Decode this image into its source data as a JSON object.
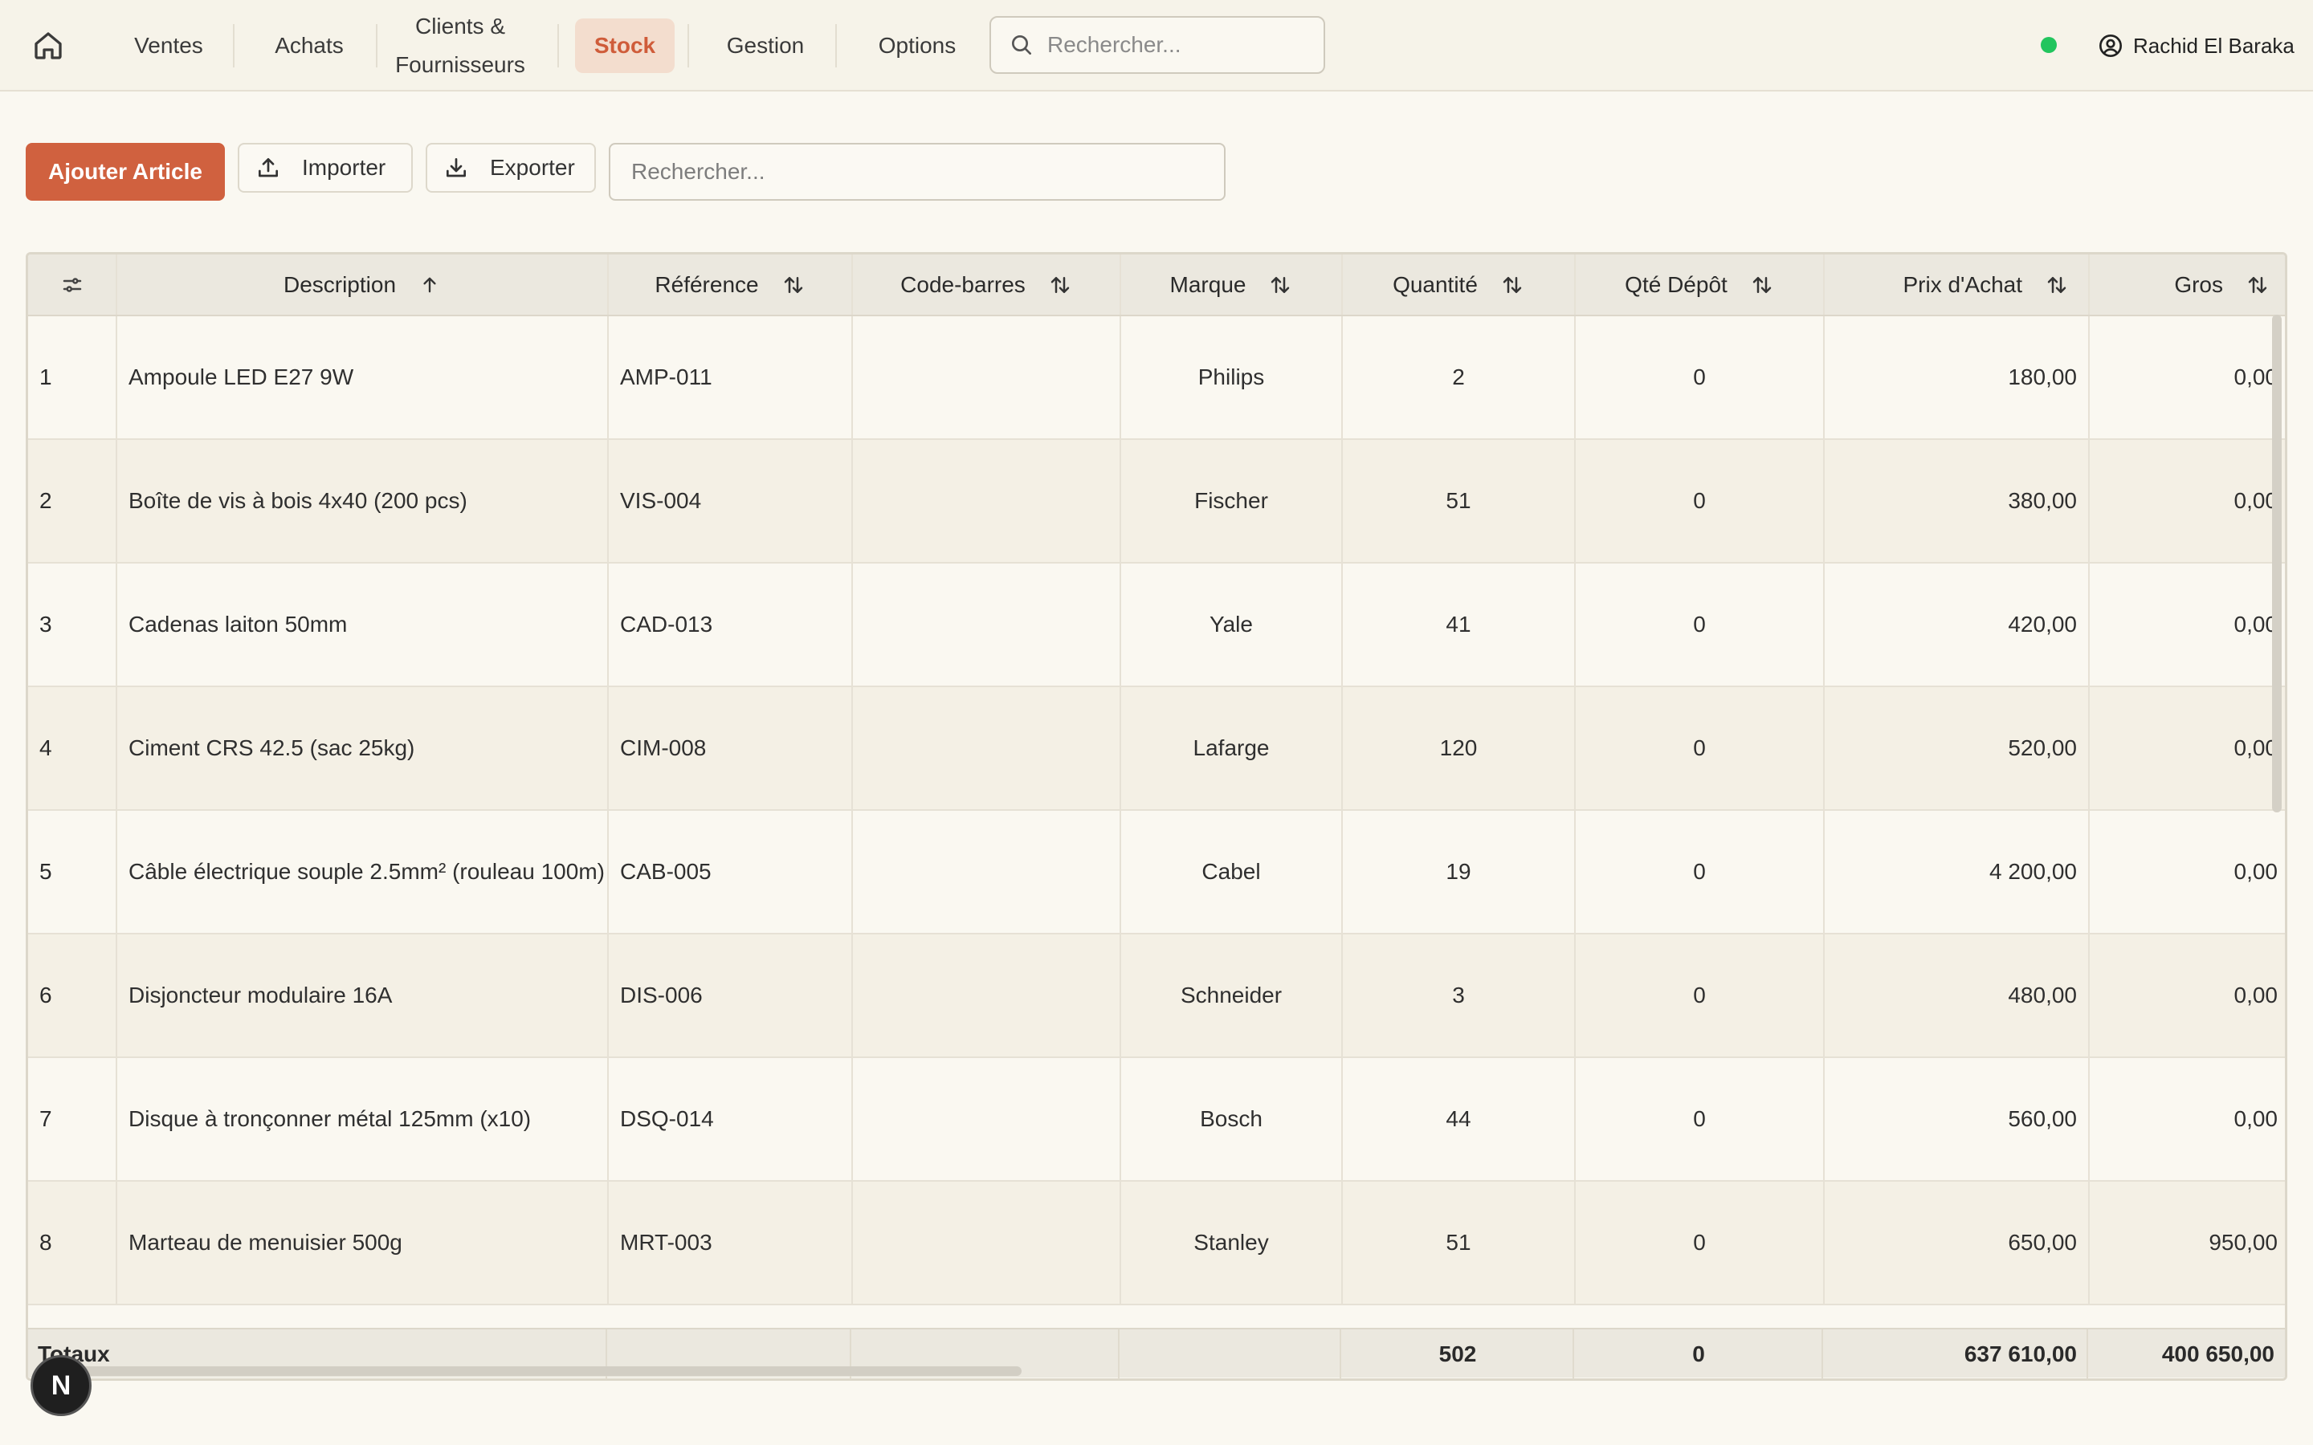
{
  "nav": {
    "items": [
      {
        "label": "Ventes"
      },
      {
        "label": "Achats"
      },
      {
        "label": "Clients & Fournisseurs"
      },
      {
        "label": "Stock"
      },
      {
        "label": "Gestion"
      },
      {
        "label": "Options"
      }
    ],
    "active": "Stock",
    "search_placeholder": "Rechercher...",
    "status": "online",
    "user_name": "Rachid El Baraka"
  },
  "toolbar": {
    "add_label": "Ajouter Article",
    "import_label": "Importer",
    "export_label": "Exporter",
    "search_placeholder": "Rechercher..."
  },
  "table": {
    "columns": [
      "Description",
      "Référence",
      "Code-barres",
      "Marque",
      "Quantité",
      "Qté Dépôt",
      "Prix d'Achat",
      "Gros"
    ],
    "sort_column": "Description",
    "sort_direction": "asc",
    "rows": [
      {
        "n": "1",
        "description": "Ampoule LED E27 9W",
        "reference": "AMP-011",
        "barcode": "",
        "brand": "Philips",
        "quantity": "2",
        "depot_qty": "0",
        "purchase_price": "180,00",
        "wholesale": "0,00"
      },
      {
        "n": "2",
        "description": "Boîte de vis à bois 4x40 (200 pcs)",
        "reference": "VIS-004",
        "barcode": "",
        "brand": "Fischer",
        "quantity": "51",
        "depot_qty": "0",
        "purchase_price": "380,00",
        "wholesale": "0,00"
      },
      {
        "n": "3",
        "description": "Cadenas laiton 50mm",
        "reference": "CAD-013",
        "barcode": "",
        "brand": "Yale",
        "quantity": "41",
        "depot_qty": "0",
        "purchase_price": "420,00",
        "wholesale": "0,00"
      },
      {
        "n": "4",
        "description": "Ciment CRS 42.5 (sac 25kg)",
        "reference": "CIM-008",
        "barcode": "",
        "brand": "Lafarge",
        "quantity": "120",
        "depot_qty": "0",
        "purchase_price": "520,00",
        "wholesale": "0,00"
      },
      {
        "n": "5",
        "description": "Câble électrique souple 2.5mm² (rouleau 100m)",
        "reference": "CAB-005",
        "barcode": "",
        "brand": "Cabel",
        "quantity": "19",
        "depot_qty": "0",
        "purchase_price": "4 200,00",
        "wholesale": "0,00"
      },
      {
        "n": "6",
        "description": "Disjoncteur modulaire 16A",
        "reference": "DIS-006",
        "barcode": "",
        "brand": "Schneider",
        "quantity": "3",
        "depot_qty": "0",
        "purchase_price": "480,00",
        "wholesale": "0,00"
      },
      {
        "n": "7",
        "description": "Disque à tronçonner métal 125mm (x10)",
        "reference": "DSQ-014",
        "barcode": "",
        "brand": "Bosch",
        "quantity": "44",
        "depot_qty": "0",
        "purchase_price": "560,00",
        "wholesale": "0,00"
      },
      {
        "n": "8",
        "description": "Marteau de menuisier 500g",
        "reference": "MRT-003",
        "barcode": "",
        "brand": "Stanley",
        "quantity": "51",
        "depot_qty": "0",
        "purchase_price": "650,00",
        "wholesale": "950,00"
      }
    ],
    "totals": {
      "label": "Totaux",
      "quantity": "502",
      "depot_qty": "0",
      "purchase_price": "637 610,00",
      "wholesale": "400 650,00"
    }
  },
  "badge": {
    "letter": "N"
  },
  "colors": {
    "accent": "#d0613f",
    "active_nav_bg": "#f3ddce",
    "status_online": "#22c55e",
    "background": "#faf8f1"
  },
  "icons": {
    "home": "home-icon",
    "search": "search-icon",
    "user": "user-circle-icon",
    "upload": "upload-icon",
    "download": "download-icon",
    "settings": "sliders-icon",
    "sort_asc": "arrow-up-icon",
    "sort": "sort-arrows-icon"
  }
}
